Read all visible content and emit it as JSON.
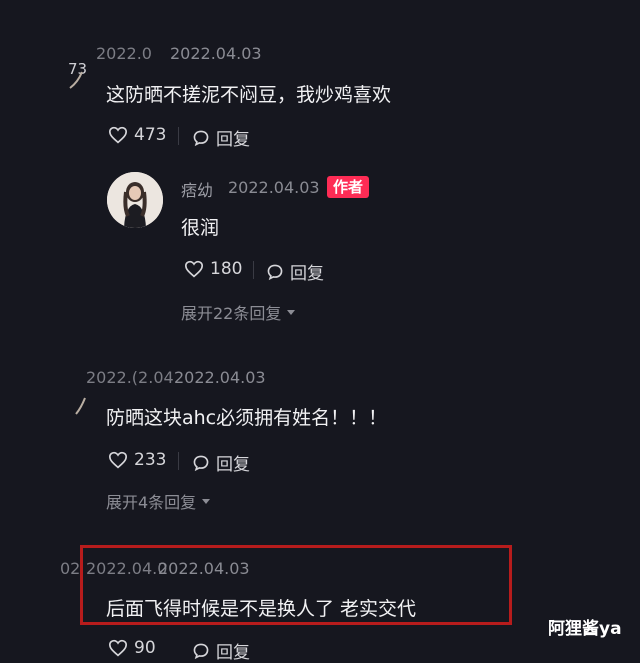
{
  "comments": [
    {
      "ts_overlap": "2022.0",
      "timestamp": "2022.04.03",
      "avatar_fragment": "73",
      "text": "这防晒不搓泥不闷豆，我炒鸡喜欢",
      "likes": "473",
      "reply_label": "回复",
      "reply": {
        "username": "痞幼",
        "timestamp": "2022.04.03",
        "badge": "作者",
        "text": "很润",
        "likes": "180",
        "reply_label": "回复",
        "expand_label": "展开22条回复"
      }
    },
    {
      "ts_overlap": "2022.(2.04",
      "timestamp": "2022.04.03",
      "text": "防晒这块ahc必须拥有姓名！！！",
      "likes": "233",
      "reply_label": "回复",
      "expand_label": "展开4条回复"
    },
    {
      "ts_overlap_left": "02",
      "ts_overlap": "2022.04.0",
      "timestamp": "2022.04.03",
      "text": "后面飞得时候是不是换人了 老实交代",
      "likes": "90",
      "reply_label": "回复"
    }
  ],
  "watermark": "阿狸酱ya",
  "colors": {
    "background": "#16171f",
    "author_badge": "#fe2c55",
    "highlight_box": "#b71c1c"
  }
}
